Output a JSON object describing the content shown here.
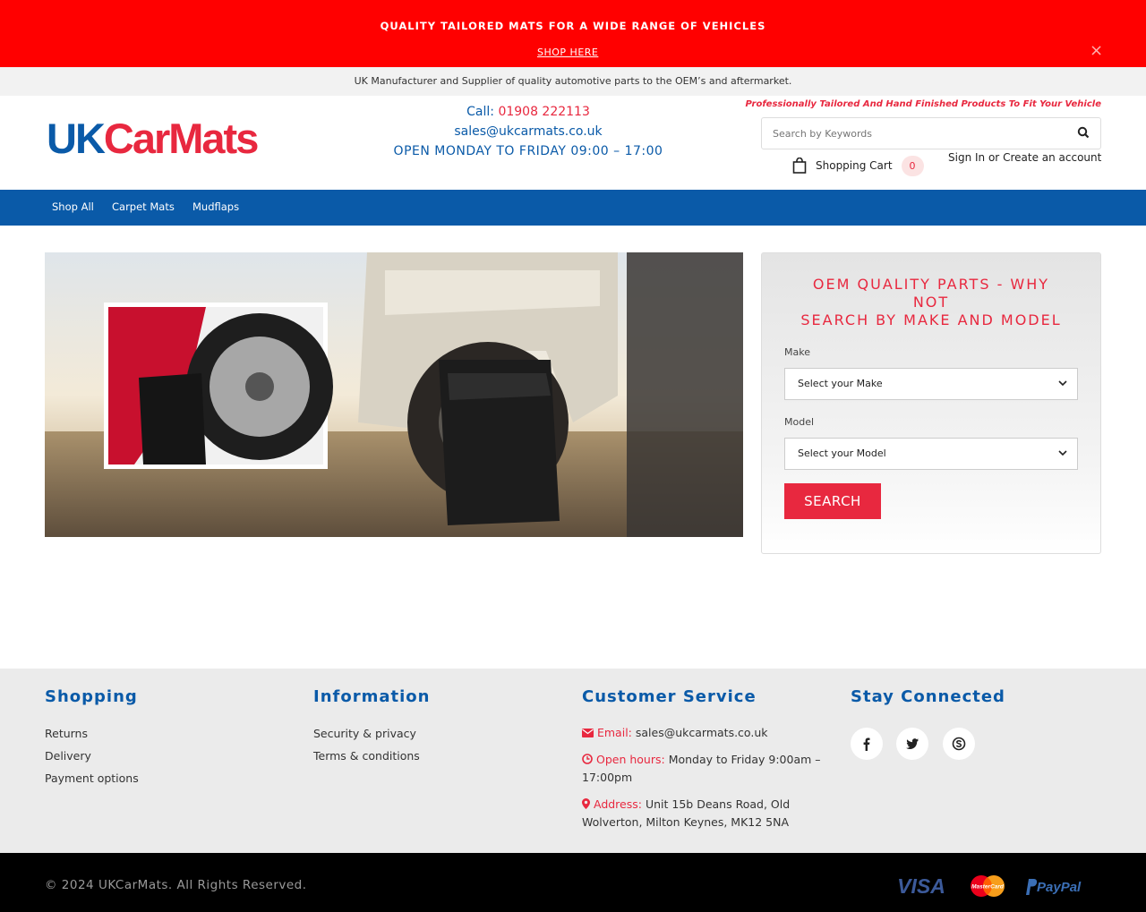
{
  "promo": {
    "title": "QUALITY TAILORED MATS FOR A WIDE RANGE OF VEHICLES",
    "link_label": "SHOP HERE",
    "close_symbol": "×"
  },
  "info_strip": "UK Manufacturer and Supplier of quality automotive parts to the OEM’s and aftermarket.",
  "logo": {
    "part1": "UK",
    "part2": "CarMats"
  },
  "contact": {
    "call_label": "Call:",
    "phone": "01908 222113",
    "email": "sales@ukcarmats.co.uk",
    "hours": "OPEN MONDAY TO FRIDAY 09:00 – 17:00"
  },
  "header": {
    "tagline": "Professionally Tailored And Hand Finished Products To Fit Your Vehicle",
    "search_placeholder": "Search by Keywords",
    "cart_label": "Shopping Cart",
    "cart_count": "0",
    "sign_in": "Sign In",
    "or": "or",
    "create_account": "Create an account"
  },
  "nav": [
    "Shop All",
    "Carpet Mats",
    "Mudflaps"
  ],
  "finder": {
    "title_line1": "OEM QUALITY PARTS - WHY",
    "title_line2": "NOT",
    "title_line3": "SEARCH BY MAKE AND MODEL",
    "make_label": "Make",
    "make_value": "Select your Make",
    "model_label": "Model",
    "model_value": "Select your Model",
    "button": "SEARCH"
  },
  "footer": {
    "shopping": {
      "heading": "Shopping",
      "links": [
        "Returns",
        "Delivery",
        "Payment options"
      ]
    },
    "information": {
      "heading": "Information",
      "links": [
        "Security & privacy",
        "Terms & conditions"
      ]
    },
    "customer_service": {
      "heading": "Customer Service",
      "email_label": "Email:",
      "email_value": "sales@ukcarmats.co.uk",
      "hours_label": "Open hours:",
      "hours_value": "Monday to Friday 9:00am – 17:00pm",
      "address_label": "Address:",
      "address_value": "Unit 15b Deans Road, Old Wolverton, Milton Keynes, MK12 5NA"
    },
    "stay_connected": {
      "heading": "Stay Connected",
      "icons": [
        "facebook-icon",
        "twitter-icon",
        "skype-icon"
      ]
    }
  },
  "bottom": {
    "copyright": "© 2024 UKCarMats. All Rights Reserved.",
    "payments": [
      "VISA",
      "MasterCard",
      "PayPal"
    ]
  },
  "colors": {
    "promo_red": "#ff0000",
    "brand_blue": "#0a5aa8",
    "accent_red": "#e8283f"
  }
}
